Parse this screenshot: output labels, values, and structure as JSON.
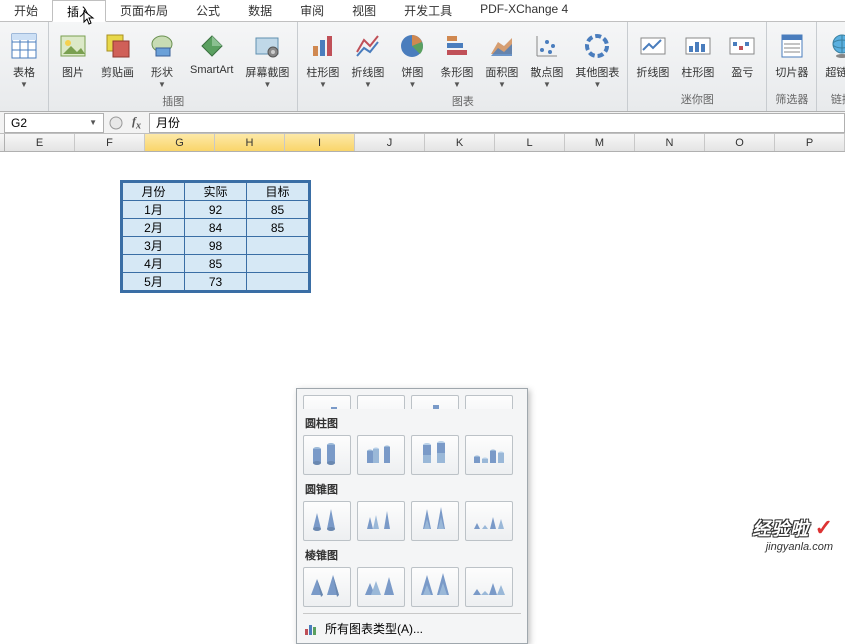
{
  "tabs": {
    "start": "开始",
    "insert": "插入",
    "layout": "页面布局",
    "formula": "公式",
    "data": "数据",
    "review": "审阅",
    "view": "视图",
    "dev": "开发工具",
    "pdf": "PDF-XChange 4"
  },
  "ribbon": {
    "tables": {
      "table": "表格"
    },
    "illustrations": {
      "picture": "图片",
      "clipart": "剪贴画",
      "shapes": "形状",
      "smartart": "SmartArt",
      "screenshot": "屏幕截图",
      "group_label": "插图"
    },
    "charts": {
      "column": "柱形图",
      "line": "折线图",
      "pie": "饼图",
      "bar": "条形图",
      "area": "面积图",
      "scatter": "散点图",
      "other": "其他图表",
      "group_label": "图表"
    },
    "sparklines": {
      "line": "折线图",
      "column": "柱形图",
      "winloss": "盈亏",
      "group_label": "迷你图"
    },
    "filter": {
      "slicer": "切片器",
      "group_label": "筛选器"
    },
    "links": {
      "hyperlink": "超链接",
      "group_label": "链接"
    }
  },
  "namebox": {
    "cell": "G2",
    "formula": "月份"
  },
  "columns": [
    "E",
    "F",
    "G",
    "H",
    "I",
    "J",
    "K",
    "L",
    "M",
    "N",
    "O",
    "P"
  ],
  "selected_cols": [
    "G",
    "H",
    "I"
  ],
  "data_table": {
    "headers": [
      "月份",
      "实际",
      "目标"
    ],
    "rows": [
      [
        "1月",
        "92",
        "85"
      ],
      [
        "2月",
        "84",
        "85"
      ],
      [
        "3月",
        "98",
        ""
      ],
      [
        "4月",
        "85",
        ""
      ],
      [
        "5月",
        "73",
        ""
      ]
    ]
  },
  "popup": {
    "section_cylinder": "圆柱图",
    "section_cone": "圆锥图",
    "section_pyramid": "棱锥图",
    "all_types": "所有图表类型(A)..."
  },
  "watermark": {
    "top": "经验啦",
    "bottom": "jingyanla.com"
  }
}
